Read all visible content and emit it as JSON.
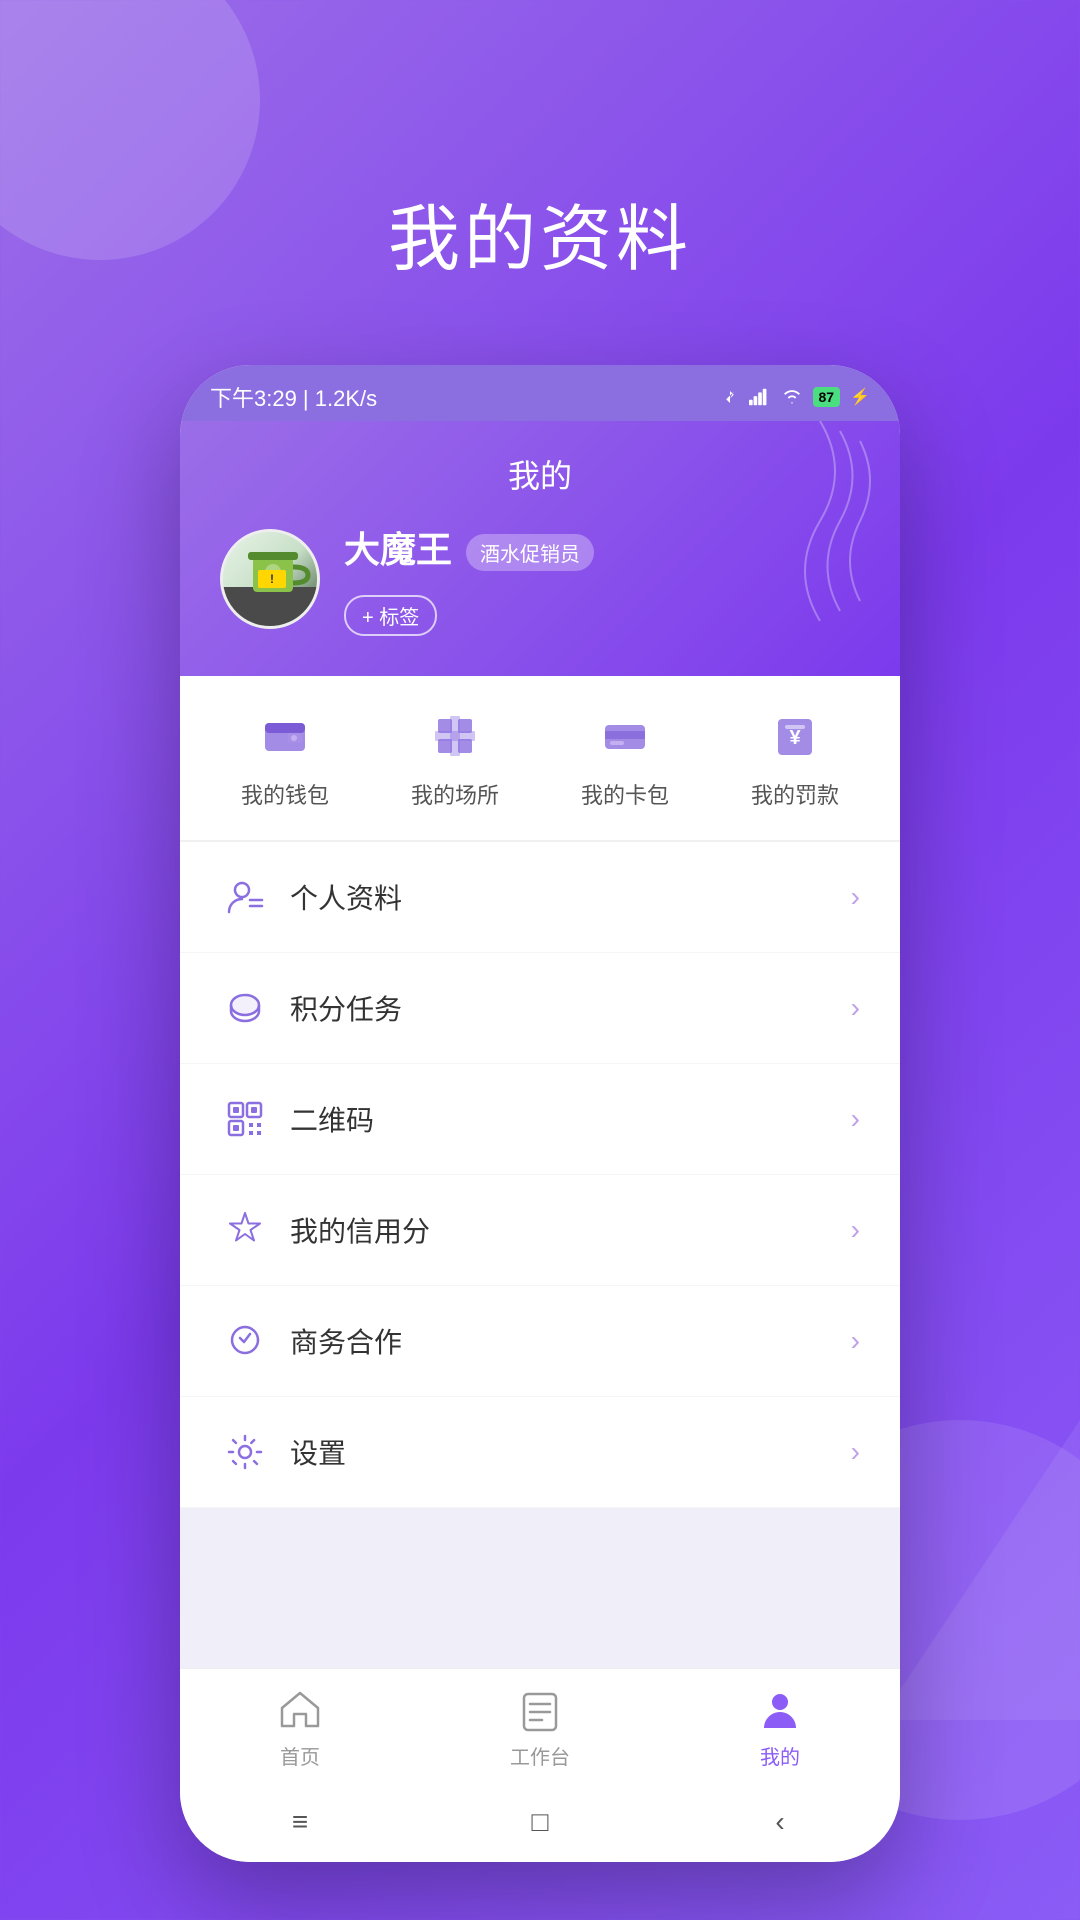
{
  "page": {
    "title": "我的资料",
    "background_color": "#8b5cf6"
  },
  "status_bar": {
    "time": "下午3:29 | 1.2K/s",
    "icons": "🔵 📶 📶 87",
    "battery": "87"
  },
  "profile_section": {
    "title": "我的",
    "user_name": "大魔王",
    "user_role_badge": "酒水促销员",
    "tag_button_label": "+ 标签"
  },
  "quick_access": [
    {
      "id": "wallet",
      "label": "我的钱包"
    },
    {
      "id": "venue",
      "label": "我的场所"
    },
    {
      "id": "card",
      "label": "我的卡包"
    },
    {
      "id": "fine",
      "label": "我的罚款"
    }
  ],
  "menu_items": [
    {
      "id": "profile",
      "label": "个人资料"
    },
    {
      "id": "points",
      "label": "积分任务"
    },
    {
      "id": "qrcode",
      "label": "二维码"
    },
    {
      "id": "credit",
      "label": "我的信用分"
    },
    {
      "id": "business",
      "label": "商务合作"
    },
    {
      "id": "settings",
      "label": "设置"
    }
  ],
  "bottom_nav": [
    {
      "id": "home",
      "label": "首页",
      "active": false
    },
    {
      "id": "workbench",
      "label": "工作台",
      "active": false
    },
    {
      "id": "mine",
      "label": "我的",
      "active": true
    }
  ],
  "system_nav": {
    "menu_icon": "≡",
    "home_icon": "□",
    "back_icon": "‹"
  }
}
